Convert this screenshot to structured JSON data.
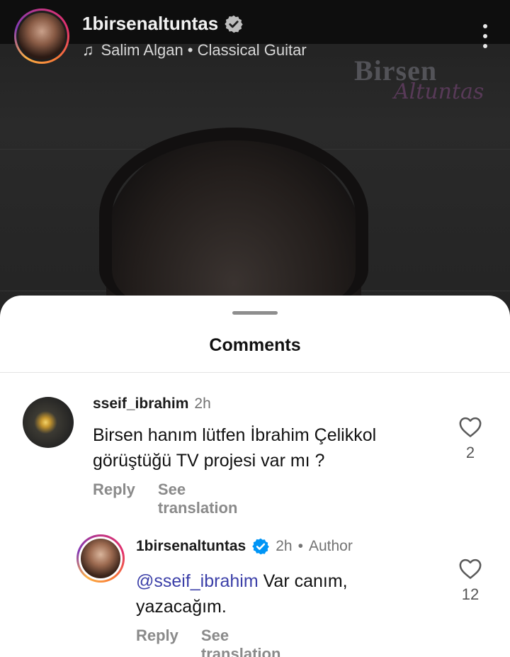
{
  "post": {
    "username": "1birsenaltuntas",
    "music": "Salim Algan • Classical Guitar",
    "watermark_line1": "Birsen",
    "watermark_line2": "Altuntas"
  },
  "sheet": {
    "title": "Comments"
  },
  "comments": [
    {
      "username": "sseif_ibrahim",
      "time": "2h",
      "text": "Birsen hanım lütfen İbrahim Çelikkol görüştüğü TV projesi var mı ?",
      "reply_label": "Reply",
      "translate_label": "See translation",
      "likes": "2"
    },
    {
      "username": "1birsenaltuntas",
      "time": "2h",
      "separator": "•",
      "author_label": "Author",
      "mention": "@sseif_ibrahim",
      "text": "Var canım, yazacağım.",
      "reply_label": "Reply",
      "translate_label": "See translation",
      "likes": "12"
    }
  ]
}
